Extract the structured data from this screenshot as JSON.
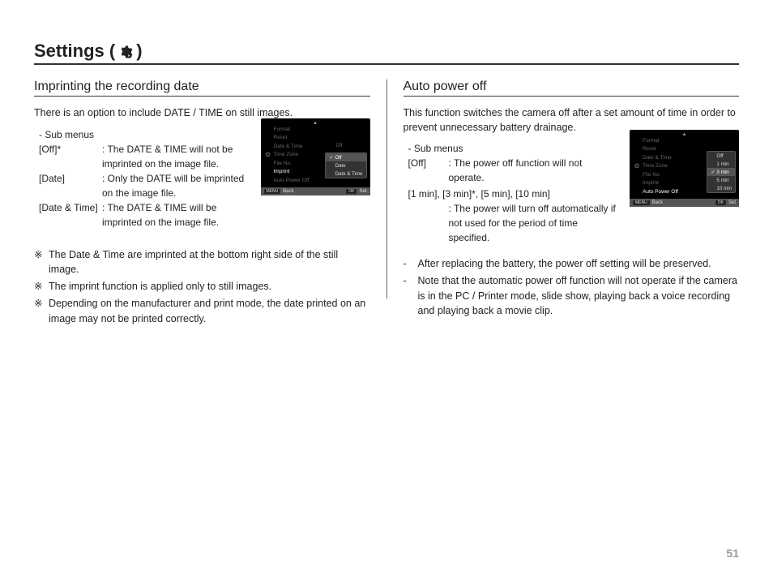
{
  "page_title_prefix": "Settings (",
  "page_title_suffix": " )",
  "page_number": "51",
  "reference_marker": "※",
  "left": {
    "section_title": "Imprinting the recording date",
    "intro": "There is an option to include DATE / TIME on still images.",
    "submenus_label": "- Sub menus",
    "items": [
      {
        "label": "[Off]*",
        "desc": ": The DATE & TIME will not be imprinted on the image file."
      },
      {
        "label": "[Date]",
        "desc": ": Only the DATE will be imprinted on the image file."
      },
      {
        "label": "[Date & Time]",
        "desc": ": The DATE & TIME will be imprinted on the image file."
      }
    ],
    "notes": [
      "The Date & Time are imprinted at the bottom right side of the still image.",
      "The imprint function is applied only to still images.",
      "Depending on the manufacturer and print mode, the date printed on an image may not be printed correctly."
    ],
    "cam": {
      "menu": [
        {
          "text": "Format",
          "dim": true
        },
        {
          "text": "Reset",
          "dim": true
        },
        {
          "text": "Date & Time",
          "right": "Off",
          "dim": true
        },
        {
          "text": "Time Zone",
          "dim": true
        },
        {
          "text": "File No.",
          "dim": true
        },
        {
          "text": "Imprint",
          "hl": true
        },
        {
          "text": "Auto Power Off",
          "dim": true
        }
      ],
      "options": [
        {
          "text": "Off",
          "sel": true,
          "check": true
        },
        {
          "text": "Date"
        },
        {
          "text": "Date & Time"
        }
      ],
      "footer": {
        "left_btn": "MENU",
        "left": "Back",
        "right_btn": "OK",
        "right": "Set"
      }
    }
  },
  "right": {
    "section_title": "Auto power off",
    "intro": "This function switches the camera off after a set amount of time in order to prevent unnecessary battery drainage.",
    "submenus_label": "- Sub menus",
    "item_off_label": "[Off]",
    "item_off_desc": ": The power off function will not operate.",
    "times_label": "[1 min], [3 min]*, [5 min], [10 min]",
    "times_desc": ": The power will turn off automatically if not used for the period of time specified.",
    "notes": [
      "After replacing the battery, the power off setting will be preserved.",
      "Note that the automatic power off function will not operate if the camera is in the PC / Printer mode, slide show, playing back a voice recording and playing back a movie clip."
    ],
    "cam": {
      "menu": [
        {
          "text": "Format",
          "dim": true
        },
        {
          "text": "Reset",
          "dim": true
        },
        {
          "text": "Date & Time",
          "dim": true
        },
        {
          "text": "Time Zone",
          "dim": true
        },
        {
          "text": "File No.",
          "dim": true
        },
        {
          "text": "Imprint",
          "dim": true
        },
        {
          "text": "Auto Power Off",
          "hl": true
        }
      ],
      "options": [
        {
          "text": "Off"
        },
        {
          "text": "1 min"
        },
        {
          "text": "3 min",
          "sel": true,
          "check": true
        },
        {
          "text": "5 min"
        },
        {
          "text": "10 min"
        }
      ],
      "footer": {
        "left_btn": "MENU",
        "left": "Back",
        "right_btn": "OK",
        "right": "Set"
      }
    }
  }
}
